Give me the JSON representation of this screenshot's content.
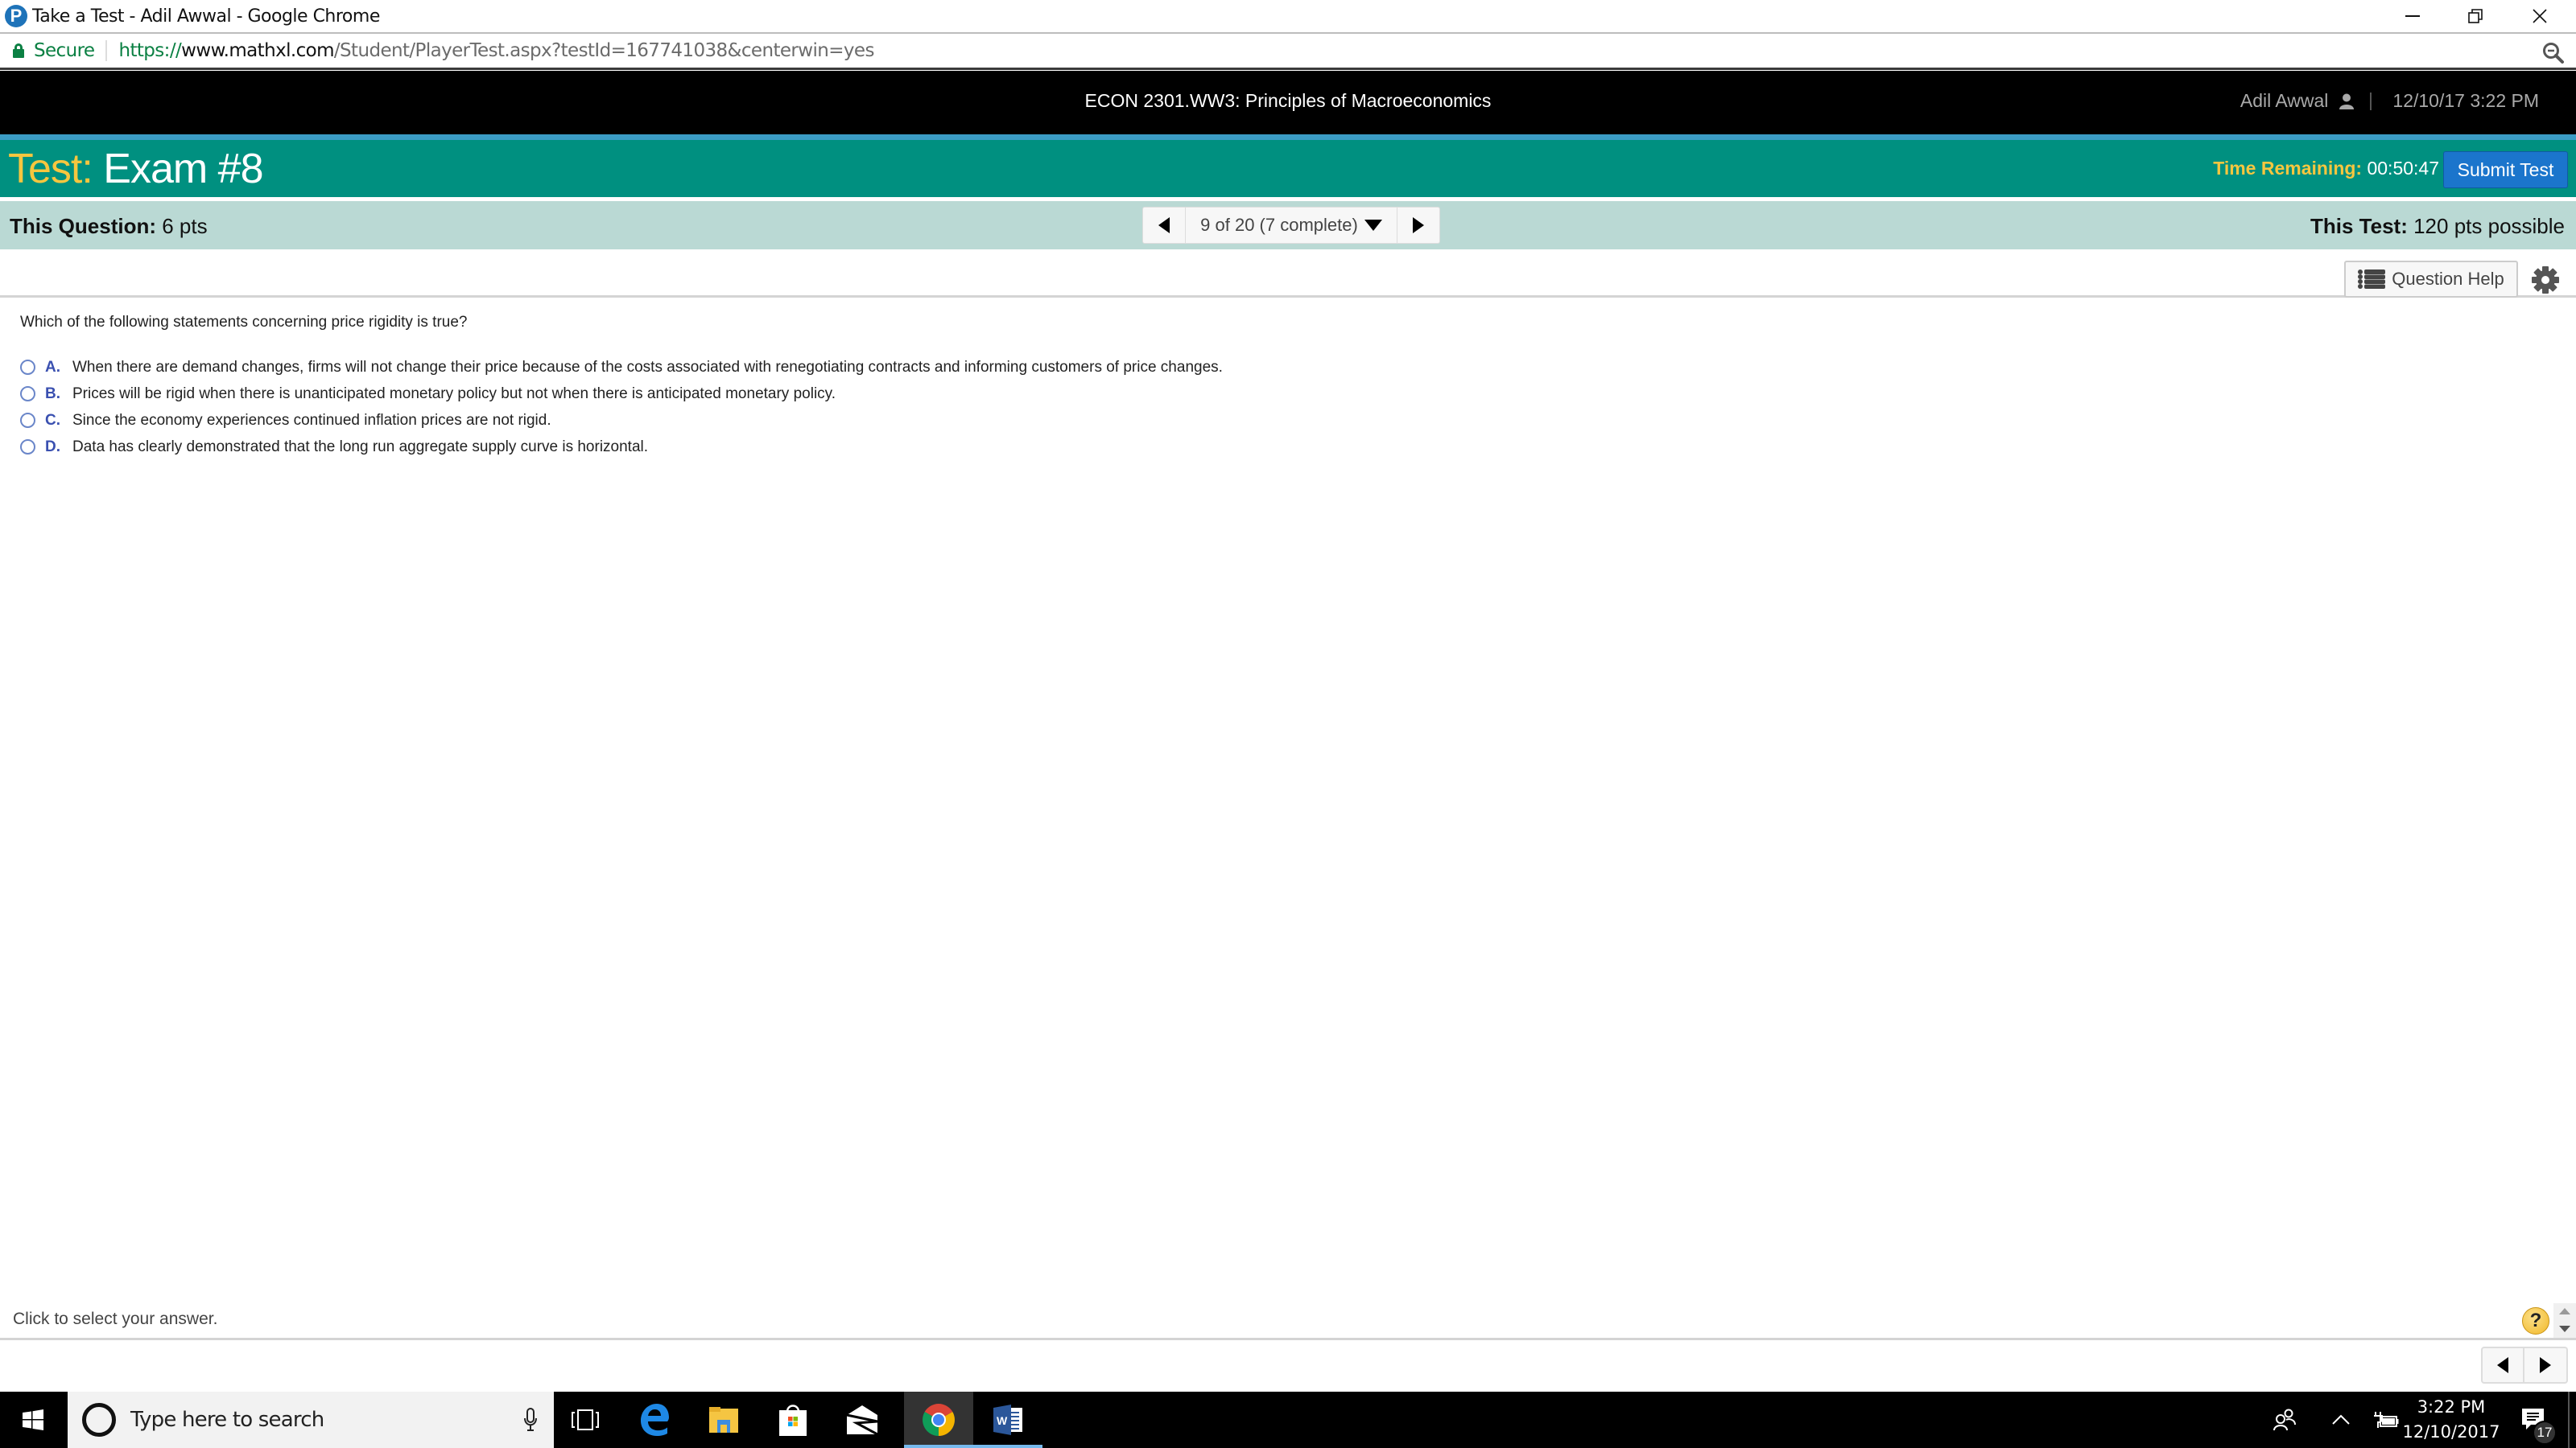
{
  "browser": {
    "window_title": "Take a Test - Adil Awwal - Google Chrome",
    "secure_label": "Secure",
    "url": {
      "scheme": "https://",
      "host": "www.mathxl.com",
      "path": "/Student/PlayerTest.aspx?testId=167741038&centerwin=yes"
    },
    "icons": [
      "mathxl-logo-icon",
      "minimize-icon",
      "restore-icon",
      "close-icon",
      "lock-icon",
      "zoom-out-icon"
    ]
  },
  "header": {
    "course_title": "ECON 2301.WW3: Principles of Macroeconomics",
    "user_name": "Adil Awwal",
    "datetime": "12/10/17 3:22 PM"
  },
  "test": {
    "prefix": "Test:",
    "name": "Exam #8",
    "time_label": "Time Remaining:",
    "time_value": "00:50:47",
    "submit_label": "Submit Test"
  },
  "info": {
    "question_label": "This Question:",
    "question_points": "6 pts",
    "test_label": "This Test:",
    "test_points": "120 pts possible",
    "navigator": "9 of 20 (7 complete)",
    "current_question": 9,
    "total_questions": 20,
    "completed": 7
  },
  "tools": {
    "question_help_label": "Question Help"
  },
  "question": {
    "text": "Which of the following statements concerning price rigidity is true?",
    "options": [
      {
        "letter": "A.",
        "text": "When there are demand changes, firms will not change their price because of the costs associated with renegotiating contracts and informing customers of price changes."
      },
      {
        "letter": "B.",
        "text": "Prices will be rigid when there is unanticipated monetary policy but not when there is anticipated monetary policy."
      },
      {
        "letter": "C.",
        "text": "Since the economy experiences continued inflation prices are not rigid."
      },
      {
        "letter": "D.",
        "text": "Data has clearly demonstrated that the long run aggregate supply curve is horizontal."
      }
    ]
  },
  "footer": {
    "status": "Click to select your answer.",
    "help_symbol": "?"
  },
  "taskbar": {
    "search_placeholder": "Type here to search",
    "apps": [
      "task-view",
      "edge",
      "file-explorer",
      "store",
      "mail",
      "chrome",
      "word"
    ],
    "active_app": "chrome",
    "time": "3:22 PM",
    "date": "12/10/2017",
    "notification_count": "17"
  },
  "colors": {
    "teal": "#009080",
    "light_teal": "#bad9d4",
    "accent_yellow": "#f6c63f",
    "submit_blue": "#1b75cc",
    "stripe_blue": "#3b9cc4",
    "secure_green": "#0b8043"
  }
}
